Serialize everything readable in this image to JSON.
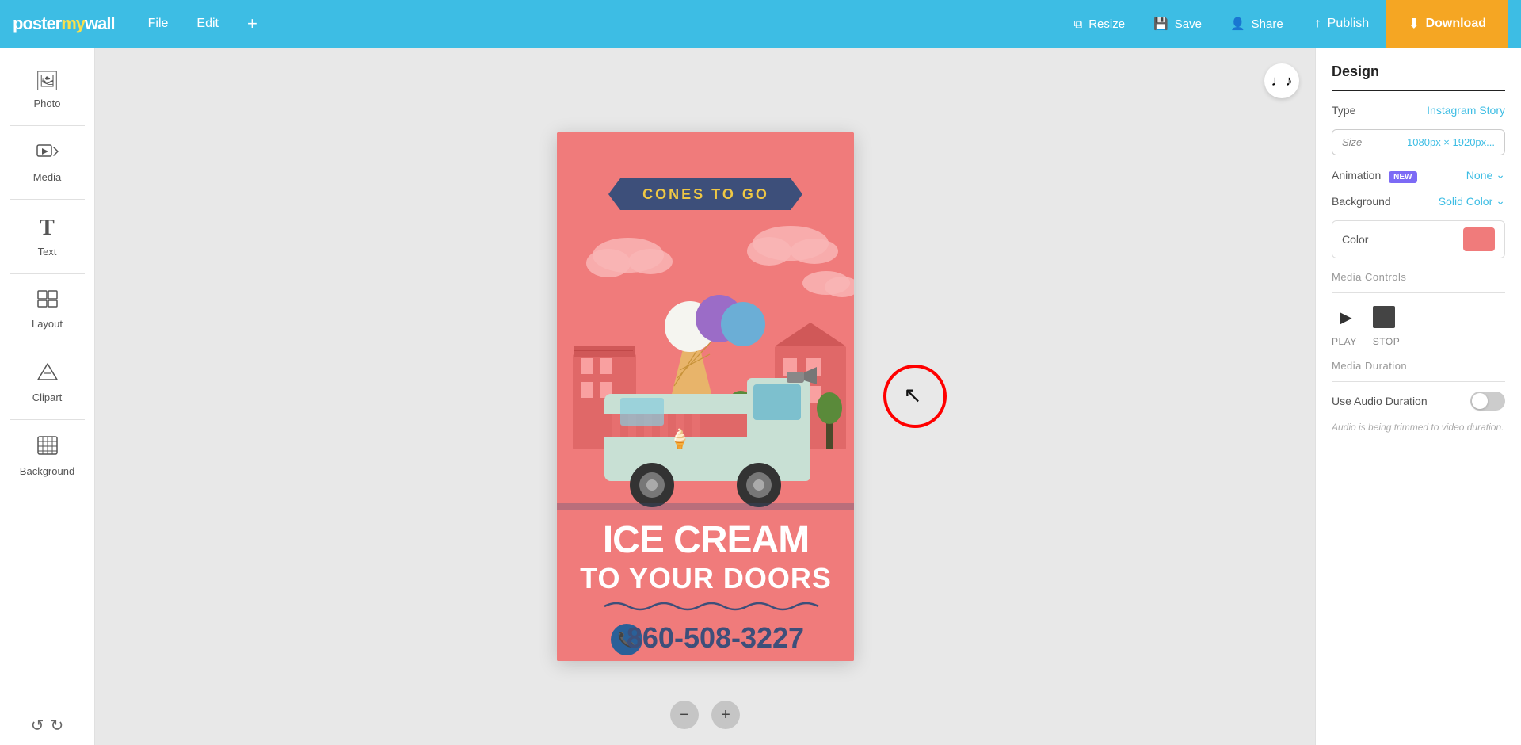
{
  "logo": {
    "text1": "poster",
    "text2": "my",
    "text3": "wall"
  },
  "nav": {
    "file": "File",
    "edit": "Edit",
    "add": "+",
    "resize": "Resize",
    "save": "Save",
    "share": "Share",
    "publish": "Publish",
    "download": "Download"
  },
  "sidebar": {
    "items": [
      {
        "id": "photo",
        "label": "Photo",
        "icon": "🖼"
      },
      {
        "id": "media",
        "label": "Media",
        "icon": "🎬"
      },
      {
        "id": "text",
        "label": "Text",
        "icon": "T"
      },
      {
        "id": "layout",
        "label": "Layout",
        "icon": "⊞"
      },
      {
        "id": "clipart",
        "label": "Clipart",
        "icon": "△"
      },
      {
        "id": "background",
        "label": "Background",
        "icon": "▦"
      }
    ]
  },
  "panel": {
    "title": "Design",
    "type_label": "Type",
    "type_value": "Instagram Story",
    "size_label": "Size",
    "size_value": "1080px × 1920px...",
    "animation_label": "Animation",
    "animation_badge": "NEW",
    "animation_value": "None",
    "background_label": "Background",
    "background_value": "Solid Color",
    "color_label": "Color",
    "media_controls_label": "Media Controls",
    "play_label": "PLAY",
    "stop_label": "STOP",
    "media_duration_label": "Media Duration",
    "use_audio_label": "Use Audio Duration",
    "audio_note": "Audio is being trimmed to video duration."
  },
  "music_btn": "♩♪",
  "zoom": {
    "minus": "−",
    "plus": "+"
  }
}
